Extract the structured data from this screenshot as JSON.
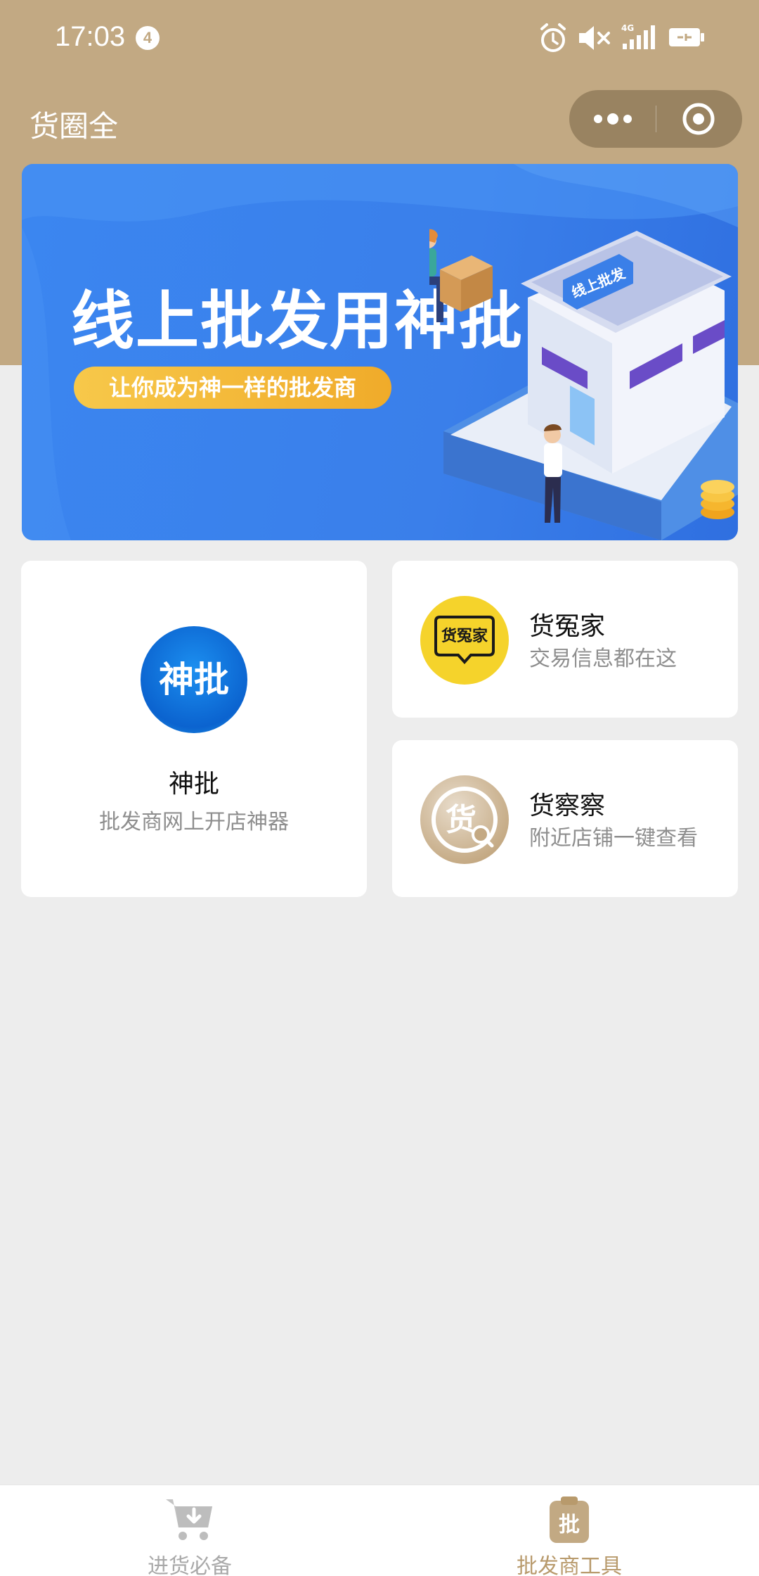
{
  "status_bar": {
    "time": "17:03",
    "notification_count": "4",
    "network": "4G"
  },
  "header": {
    "title": "货圈全"
  },
  "banner": {
    "headline": "线上批发用神批",
    "tagline": "让你成为神一样的批发商",
    "store_sign": "线上批发"
  },
  "cards": {
    "shenpi": {
      "logo_text": "神批",
      "title": "神批",
      "subtitle": "批发商网上开店神器"
    },
    "huoyuanjia": {
      "logo_text": "货冤家",
      "title": "货冤家",
      "subtitle": "交易信息都在这"
    },
    "huochacha": {
      "logo_text": "货",
      "title": "货察察",
      "subtitle": "附近店铺一键查看"
    }
  },
  "tab_bar": {
    "tabs": [
      {
        "label": "进货必备",
        "icon": "cart-download-icon",
        "active": false
      },
      {
        "label": "批发商工具",
        "icon": "clipboard-pi-icon",
        "active": true
      }
    ],
    "tab2_icon_text": "批"
  },
  "colors": {
    "header_bg": "#c2a983",
    "page_bg": "#ededed",
    "banner_blue": "#3b86f0",
    "pill_yellow": "#f7c84a",
    "active_tab": "#b89a6c",
    "inactive_tab": "#a9a9a9"
  }
}
